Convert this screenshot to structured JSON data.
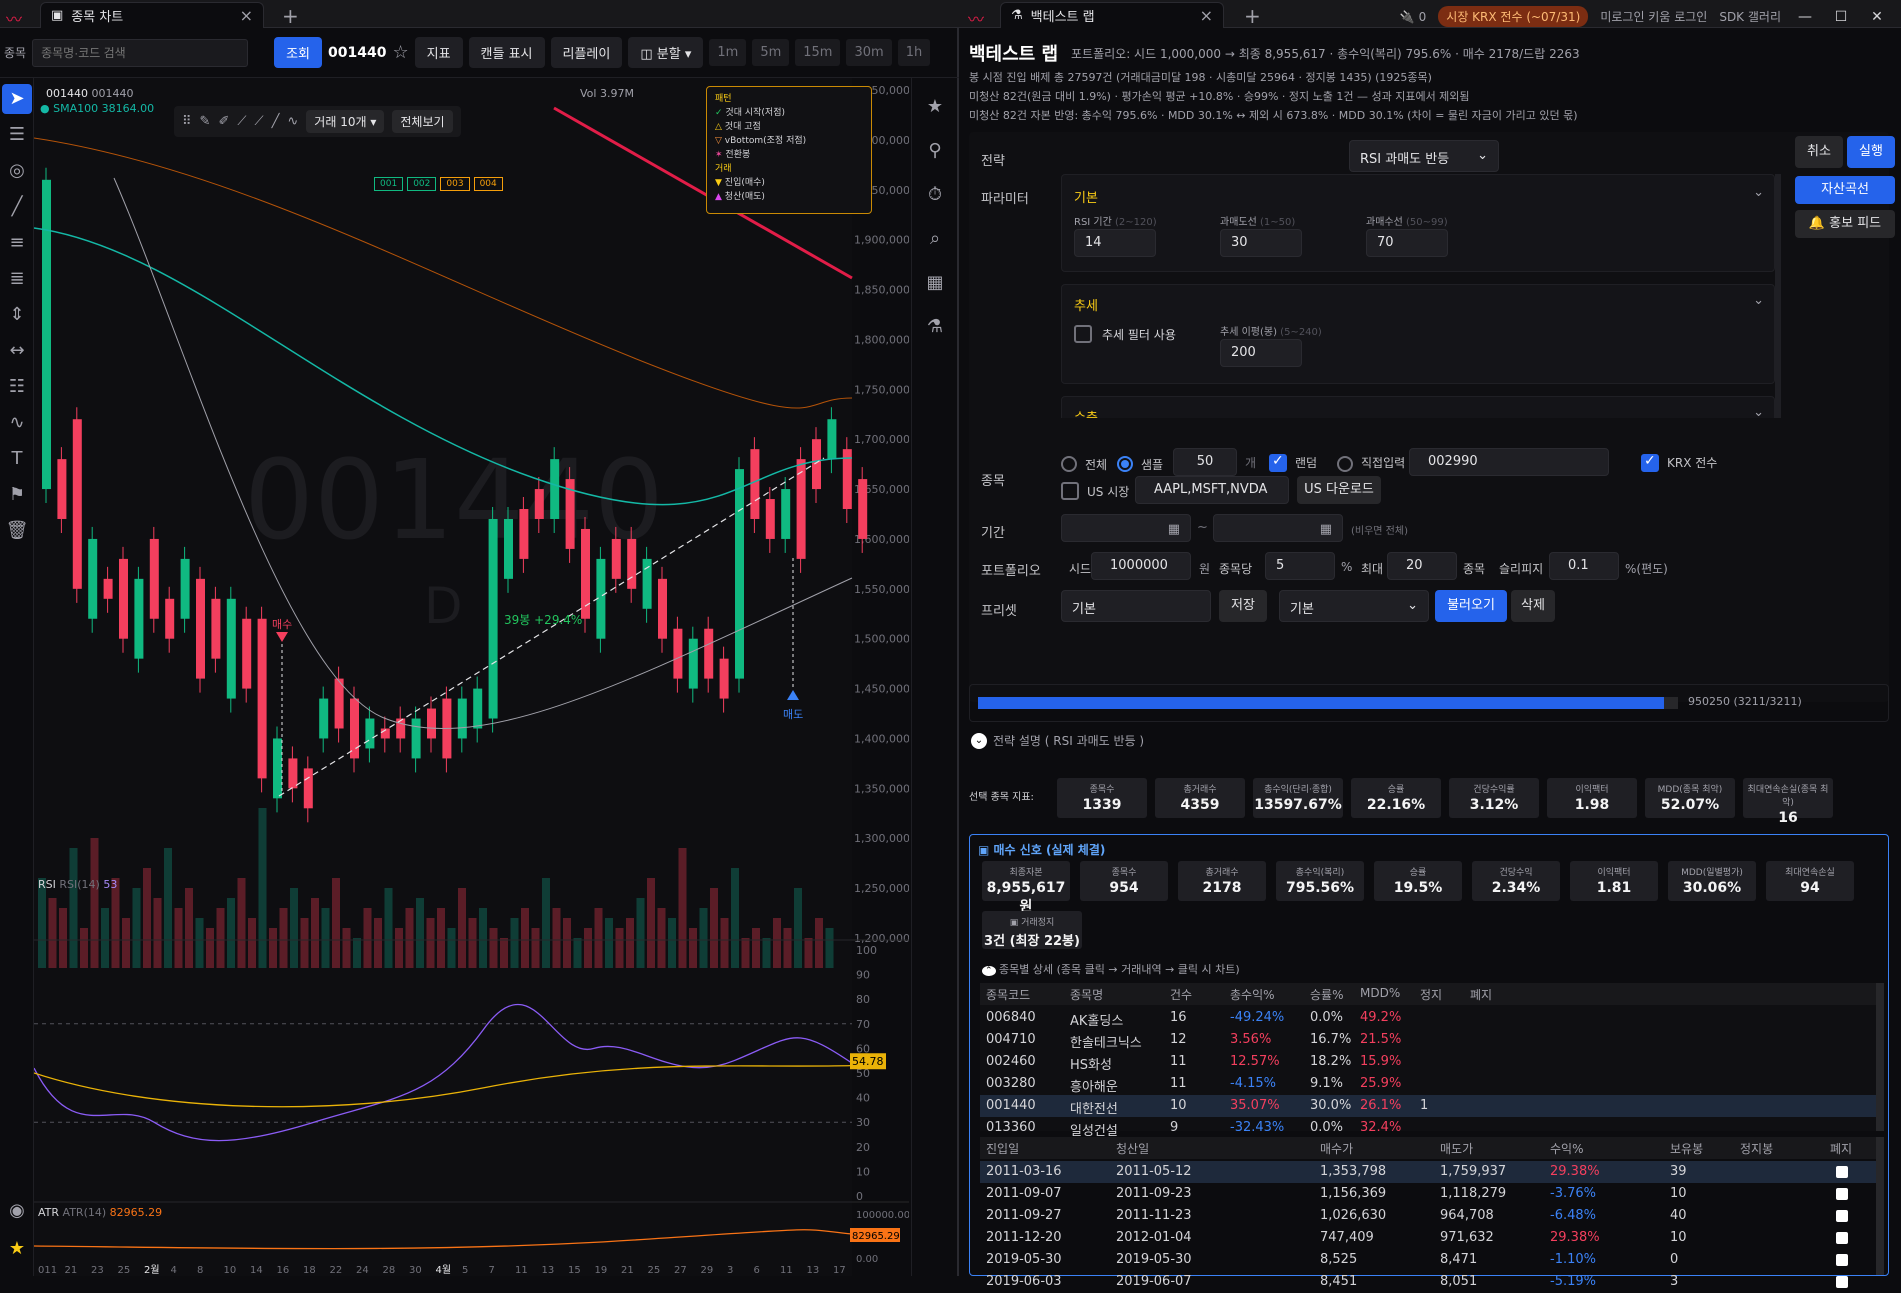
{
  "window": {
    "left_tab": "종목 차트",
    "right_tab": "백테스트 랩",
    "status_count": "0",
    "market_badge": "시장 KRX 전수 (~07/31)",
    "login": "미로그인 키움 로그인",
    "sdk": "SDK 갤러리"
  },
  "toolbar": {
    "label": "종목",
    "search_placeholder": "종목명·코드 검색",
    "query_btn": "조회",
    "code": "001440",
    "indicator": "지표",
    "candle": "캔들 표시",
    "replay": "리플레이",
    "split": "분할",
    "tf": [
      "1m",
      "5m",
      "15m",
      "30m",
      "1h"
    ]
  },
  "chart": {
    "symbol": "001440",
    "sym2": "001440",
    "sma": "SMA100 38164.00",
    "vol": "Vol 3.97M",
    "watermark": "001440",
    "wm2": "D",
    "trade_btn": "거래 10개",
    "all_btn": "전체보기",
    "tags": [
      "001",
      "002",
      "003",
      "004"
    ],
    "buy_label": "매수",
    "sell_label": "매도",
    "bars_label": "39봉 +29.4%",
    "price_ticks": [
      "2,050,000.0",
      "2,000,000.0",
      "1,950,000.0",
      "1,900,000.0",
      "1,850,000.0",
      "1,800,000.0",
      "1,750,000.0",
      "1,700,000.0",
      "1,650,000.0",
      "1,600,000.0",
      "1,550,000.0",
      "1,500,000.0",
      "1,450,000.0",
      "1,400,000.0",
      "1,350,000.0",
      "1,300,000.0",
      "1,250,000.0",
      "1,200,000.0"
    ],
    "rsi_label": "RSI",
    "rsi_param": "RSI(14)",
    "rsi_val": "53",
    "rsi_ticks": [
      "100",
      "90",
      "80",
      "70",
      "60",
      "50",
      "40",
      "30",
      "20",
      "10",
      "0"
    ],
    "rsi_badge": "54.78",
    "atr_label": "ATR",
    "atr_param": "ATR(14)",
    "atr_val": "82965.29",
    "atr_ticks": [
      "100000.00",
      "0.00"
    ],
    "atr_badge": "82965.29",
    "x_ticks": [
      "011",
      "21",
      "23",
      "25",
      "2월",
      "4",
      "8",
      "10",
      "14",
      "16",
      "18",
      "22",
      "24",
      "28",
      "30",
      "4월",
      "5",
      "7",
      "11",
      "13",
      "15",
      "19",
      "21",
      "25",
      "27",
      "29",
      "3",
      "6",
      "11",
      "13",
      "17"
    ],
    "legend": {
      "title1": "패턴",
      "items": [
        "것대 시작(저점)",
        "것대 고점",
        "vBottom(조정 저점)",
        "전환봉"
      ],
      "title2": "거래",
      "items2": [
        "진입(매수)",
        "청산(매도)"
      ]
    },
    "chart_data": {
      "type": "candlestick",
      "symbol": "001440",
      "price_range": [
        1200000,
        2050000
      ],
      "rsi_range": [
        0,
        100
      ],
      "atr_range": [
        0,
        100000
      ]
    }
  },
  "bt": {
    "title": "백테스트 랩",
    "summary": "포트폴리오: 시드 1,000,000 → 최종 8,955,617 · 총수익(복리) 795.6% · 매수 2178/드랍 2263",
    "line1": "봉 시점 진입 배제 총 27597건 (거래대금미달 198 · 시총미달 25964 · 정지봉 1435) (1925종목)",
    "line2": "미청산 82건(원금 대비 1.9%) · 평가손익 평균 +10.8% · 승99% · 정지 노출 1건 — 성과 지표에서 제외됨",
    "line3": "미청산 82건 자본 반영: 총수익 795.6% · MDD 30.1% ↔ 제외 시 673.8% · MDD 30.1% (차이 = 물린 자금이 가리고 있던 몫)",
    "strategy_label": "전략",
    "strategy": "RSI 과매도 반등",
    "cancel": "취소",
    "run": "실행",
    "equity": "자산곡선",
    "promo": "홍보 피드",
    "param_label": "파라미터",
    "basic": "기본",
    "rsi_period_label": "RSI 기간",
    "rsi_period_range": "(2~120)",
    "rsi_period": "14",
    "os_label": "과매도선",
    "os_range": "(1~50)",
    "os": "30",
    "ob_label": "과매수선",
    "ob_range": "(50~99)",
    "ob": "70",
    "trend": "추세",
    "trend_filter": "추세 필터 사용",
    "trend_ma_label": "추세 이평(봉)",
    "trend_ma_range": "(5~240)",
    "trend_ma": "200",
    "shrink": "수축",
    "universe_label": "종목",
    "all": "전체",
    "sample": "샘플",
    "sample_n": "50",
    "unit": "개",
    "random": "랜덤",
    "direct": "직접입력",
    "direct_code": "002990",
    "krx": "KRX 전수",
    "us": "US 시장",
    "us_codes": "AAPL,MSFT,NVDA",
    "us_dl": "US 다운로드",
    "period_label": "기간",
    "period_hint": "(비우면 전체)",
    "pf_label": "포트폴리오",
    "seed_label": "시드",
    "seed": "1000000",
    "won": "원",
    "per_label": "종목당",
    "per": "5",
    "pct": "%",
    "max_label": "최대",
    "max": "20",
    "jm": "종목",
    "slip_label": "슬리피지",
    "slip": "0.1",
    "slip_unit": "%(편도)",
    "preset_label": "프리셋",
    "preset_name": "기본",
    "save": "저장",
    "preset_sel": "기본",
    "load": "불러오기",
    "del": "삭제",
    "progress_text": "950250 (3211/3211)",
    "progress": 0.98,
    "desc": "전략 설명 ( RSI 과매도 반등 )",
    "sel_label": "선택 종목 지표:",
    "sel_stats": [
      {
        "t": "종목수",
        "v": "1339"
      },
      {
        "t": "총거래수",
        "v": "4359"
      },
      {
        "t": "총수익(단리·종합)",
        "v": "13597.67%"
      },
      {
        "t": "승률",
        "v": "22.16%"
      },
      {
        "t": "건당수익률",
        "v": "3.12%"
      },
      {
        "t": "이익팩터",
        "v": "1.98"
      },
      {
        "t": "MDD(종목 최악)",
        "v": "52.07%"
      },
      {
        "t": "최대연속손실(종목 최악)",
        "v": "16"
      }
    ],
    "buy_title": "매수 신호 (실제 체결)",
    "buy_stats": [
      {
        "t": "최종자본",
        "v": "8,955,617원"
      },
      {
        "t": "종목수",
        "v": "954"
      },
      {
        "t": "총거래수",
        "v": "2178"
      },
      {
        "t": "총수익(복리)",
        "v": "795.56%"
      },
      {
        "t": "승률",
        "v": "19.5%"
      },
      {
        "t": "건당수익",
        "v": "2.34%"
      },
      {
        "t": "이익팩터",
        "v": "1.81"
      },
      {
        "t": "MDD(일별평가)",
        "v": "30.06%"
      },
      {
        "t": "최대연속손실",
        "v": "94"
      }
    ],
    "halt_t": "거래정지",
    "halt_v": "3건 (최장 22봉)",
    "detail_title": "종목별 상세 (종목 클릭 → 거래내역 → 클릭 시 차트)",
    "t1_headers": [
      "종목코드",
      "종목명",
      "건수",
      "총수익%",
      "승률%",
      "MDD%",
      "정지",
      "폐지"
    ],
    "t1_rows": [
      [
        "006840",
        "AK홀딩스",
        "16",
        "-49.24%",
        "0.0%",
        "49.2%",
        ""
      ],
      [
        "004710",
        "한솔테크닉스",
        "12",
        "3.56%",
        "16.7%",
        "21.5%",
        ""
      ],
      [
        "002460",
        "HS화성",
        "11",
        "12.57%",
        "18.2%",
        "15.9%",
        ""
      ],
      [
        "003280",
        "흥아해운",
        "11",
        "-4.15%",
        "9.1%",
        "25.9%",
        ""
      ],
      [
        "001440",
        "대한전선",
        "10",
        "35.07%",
        "30.0%",
        "26.1%",
        "1"
      ],
      [
        "013360",
        "일성건설",
        "9",
        "-32.43%",
        "0.0%",
        "32.4%",
        ""
      ]
    ],
    "t2_headers": [
      "진입일",
      "청산일",
      "매수가",
      "매도가",
      "수익%",
      "보유봉",
      "정지봉",
      "폐지"
    ],
    "t2_rows": [
      [
        "2011-03-16",
        "2011-05-12",
        "1,353,798",
        "1,759,937",
        "29.38%",
        "39"
      ],
      [
        "2011-09-07",
        "2011-09-23",
        "1,156,369",
        "1,118,279",
        "-3.76%",
        "10"
      ],
      [
        "2011-09-27",
        "2011-11-23",
        "1,026,630",
        "964,708",
        "-6.48%",
        "40"
      ],
      [
        "2011-12-20",
        "2012-01-04",
        "747,409",
        "971,632",
        "29.38%",
        "10"
      ],
      [
        "2019-05-30",
        "2019-05-30",
        "8,525",
        "8,471",
        "-1.10%",
        "0"
      ],
      [
        "2019-06-03",
        "2019-06-07",
        "8,451",
        "8,051",
        "-5.19%",
        "3"
      ]
    ]
  }
}
